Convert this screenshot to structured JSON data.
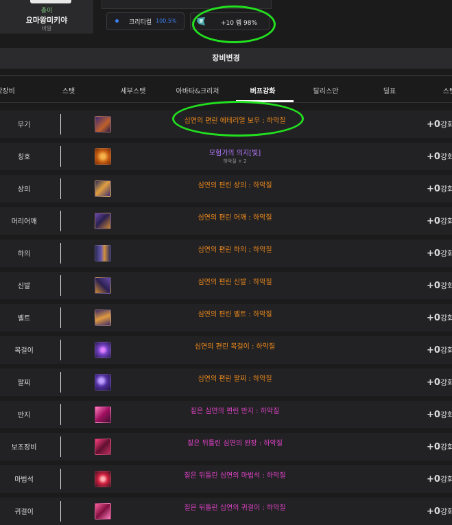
{
  "character": {
    "server": "총이",
    "name": "요마왕미키야",
    "class": "바알"
  },
  "stats": {
    "crit_label": "크리티컬",
    "crit_value": "100.5%",
    "gem_text": "+10 렙 98%"
  },
  "section_title": "장비변경",
  "tabs": [
    {
      "label": "착장비"
    },
    {
      "label": "스탯"
    },
    {
      "label": "세부스탯"
    },
    {
      "label": "아바타&크리쳐"
    },
    {
      "label": "버프강화"
    },
    {
      "label": "탈리스만"
    },
    {
      "label": "딜표"
    },
    {
      "label": "스탯"
    }
  ],
  "colors": {
    "orange": "#f08a1c",
    "purple": "#b57bff",
    "magenta": "#e043c8",
    "annotation_green": "#22e01f"
  },
  "rows": [
    {
      "slot": "무기",
      "item": "심연의 편린 에테리얼 보우 : 하악질",
      "color": "#f08a1c",
      "enh": "+0",
      "enh_unit": "강화",
      "icon": "weapon-bow-icon"
    },
    {
      "slot": "칭호",
      "item": "모험가의 의지[빛]",
      "sub": "하악질 + 2",
      "color": "#b57bff",
      "enh": "+0",
      "enh_unit": "강화",
      "icon": "title-icon"
    },
    {
      "slot": "상의",
      "item": "심연의 편린 상의 : 하악질",
      "color": "#f08a1c",
      "enh": "+0",
      "enh_unit": "강화",
      "icon": "top-armor-icon"
    },
    {
      "slot": "머리어깨",
      "item": "심연의 편린 어깨 : 하악질",
      "color": "#f08a1c",
      "enh": "+0",
      "enh_unit": "강화",
      "icon": "shoulder-armor-icon"
    },
    {
      "slot": "하의",
      "item": "심연의 편린 하의 : 하악질",
      "color": "#f08a1c",
      "enh": "+0",
      "enh_unit": "강화",
      "icon": "pants-armor-icon"
    },
    {
      "slot": "신발",
      "item": "심연의 편린 신발 : 하악질",
      "color": "#f08a1c",
      "enh": "+0",
      "enh_unit": "강화",
      "icon": "shoes-armor-icon"
    },
    {
      "slot": "벨트",
      "item": "심연의 편린 벨트 : 하악질",
      "color": "#f08a1c",
      "enh": "+0",
      "enh_unit": "강화",
      "icon": "belt-armor-icon"
    },
    {
      "slot": "목걸이",
      "item": "심연의 편린 목걸이 : 하악질",
      "color": "#f08a1c",
      "enh": "+0",
      "enh_unit": "강화",
      "icon": "necklace-icon"
    },
    {
      "slot": "팔찌",
      "item": "심연의 편린 팔찌 : 하악질",
      "color": "#f08a1c",
      "enh": "+0",
      "enh_unit": "강화",
      "icon": "bracelet-icon"
    },
    {
      "slot": "반지",
      "item": "짙은 심연의 편린 반지 : 하악질",
      "color": "#e043c8",
      "enh": "+0",
      "enh_unit": "강화",
      "icon": "ring-icon"
    },
    {
      "slot": "보조장비",
      "item": "짙은 뒤틀린 심연의 완장 : 하악질",
      "color": "#e043c8",
      "enh": "+0",
      "enh_unit": "강화",
      "icon": "sub-equipment-icon"
    },
    {
      "slot": "마법석",
      "item": "짙은 뒤틀린 심연의 마법석 : 하악질",
      "color": "#e043c8",
      "enh": "+0",
      "enh_unit": "강화",
      "icon": "magic-stone-icon"
    },
    {
      "slot": "귀걸이",
      "item": "짙은 뒤틀린 심연의 귀걸이 : 하악질",
      "color": "#e043c8",
      "enh": "+0",
      "enh_unit": "강화",
      "icon": "earring-icon"
    }
  ]
}
